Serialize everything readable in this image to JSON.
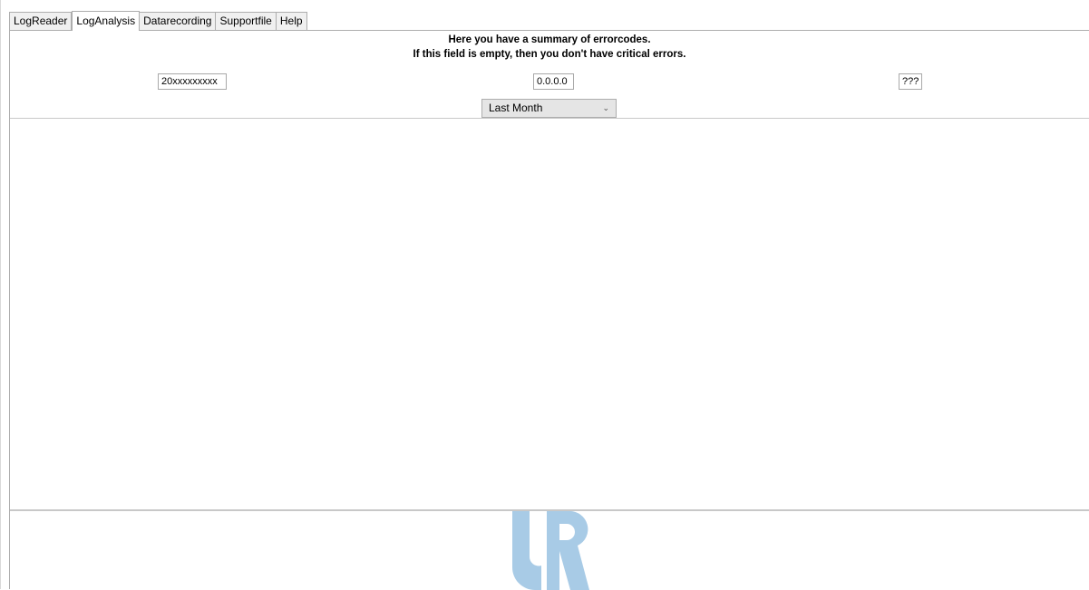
{
  "tabs": [
    {
      "label": "LogReader",
      "active": false
    },
    {
      "label": "LogAnalysis",
      "active": true
    },
    {
      "label": "Datarecording",
      "active": false
    },
    {
      "label": "Supportfile",
      "active": false
    },
    {
      "label": "Help",
      "active": false
    }
  ],
  "summary": {
    "line1": "Here you have a summary of errorcodes.",
    "line2": "If this field is empty, then you don't have critical errors."
  },
  "fields": {
    "serial": "20xxxxxxxxx",
    "ip": "0.0.0.0",
    "version": "???"
  },
  "period_select": {
    "selected": "Last Month"
  },
  "icons": {
    "dropdown": "chevron-down-icon",
    "logo": "ur-logo"
  },
  "colors": {
    "logo": "#a8cbe6"
  }
}
